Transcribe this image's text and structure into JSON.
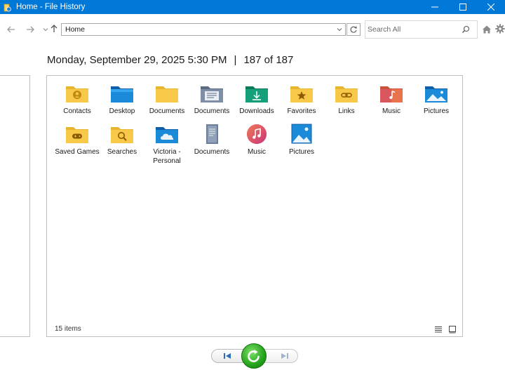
{
  "window": {
    "title": "Home - File History"
  },
  "toolbar": {
    "address_value": "Home",
    "search_placeholder": "Search All"
  },
  "header": {
    "datetime": "Monday, September 29, 2025 5:30 PM",
    "separator": "|",
    "position": "187 of 187"
  },
  "items": [
    {
      "label": "Contacts",
      "icon": "contacts-folder-icon"
    },
    {
      "label": "Desktop",
      "icon": "desktop-folder-icon"
    },
    {
      "label": "Documents",
      "icon": "documents-folder-icon"
    },
    {
      "label": "Documents",
      "icon": "documents-library-icon"
    },
    {
      "label": "Downloads",
      "icon": "downloads-folder-icon"
    },
    {
      "label": "Favorites",
      "icon": "favorites-folder-icon"
    },
    {
      "label": "Links",
      "icon": "links-folder-icon"
    },
    {
      "label": "Music",
      "icon": "music-folder-icon"
    },
    {
      "label": "Pictures",
      "icon": "pictures-folder-icon"
    },
    {
      "label": "Saved Games",
      "icon": "saved-games-folder-icon"
    },
    {
      "label": "Searches",
      "icon": "searches-folder-icon"
    },
    {
      "label": "Victoria - Personal",
      "icon": "onedrive-folder-icon"
    },
    {
      "label": "Documents",
      "icon": "documents-library-icon"
    },
    {
      "label": "Music",
      "icon": "music-library-icon"
    },
    {
      "label": "Pictures",
      "icon": "pictures-library-icon"
    }
  ],
  "status": {
    "count": "15 items"
  },
  "colors": {
    "titlebar": "#0078d7",
    "folder_yellow": "#f8c948",
    "restore_green": "#25a31c"
  }
}
